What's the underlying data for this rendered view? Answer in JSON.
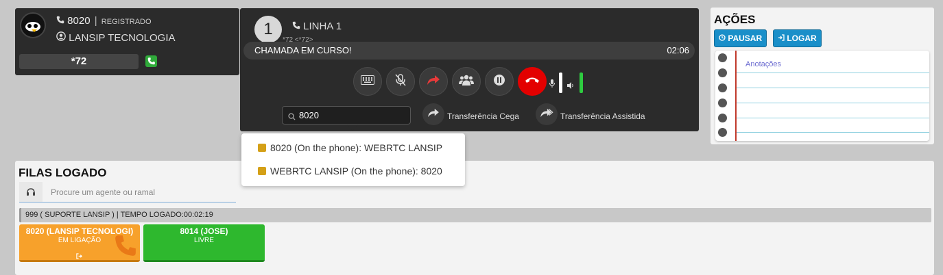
{
  "extension": {
    "number": "8020",
    "separator": "|",
    "status": "REGISTRADO",
    "company": "LANSIP TECNOLOGIA",
    "code": "*72"
  },
  "call": {
    "line_number": "1",
    "line_label": "LINHA 1",
    "line_sub": "*72 <*72>",
    "status": "CHAMADA EM CURSO!",
    "timer": "02:06",
    "search_value": "8020",
    "blind_transfer": "Transferência Cega",
    "assisted_transfer": "Transferência Assistida",
    "buttons": [
      "keypad-icon",
      "mic-muted-icon",
      "forward-icon",
      "group-icon",
      "pause-icon",
      "hangup-icon"
    ],
    "hangup_color": "#e30000"
  },
  "dropdown": {
    "items": [
      "8020 (On the phone): WEBRTC LANSIP",
      "WEBRTC LANSIP (On the phone): 8020"
    ]
  },
  "acoes": {
    "title": "AÇÕES",
    "pause_label": "PAUSAR",
    "login_label": "LOGAR",
    "notes_placeholder": "Anotações",
    "button_color": "#1a8fc9"
  },
  "filas": {
    "title": "FILAS LOGADO",
    "search_placeholder": "Procure um agente ou ramal",
    "queue_info": "999 ( SUPORTE LANSIP ) | TEMPO LOGADO:00:02:19",
    "agents": [
      {
        "name": "8020 (LANSIP TECNOLOGI)",
        "status": "EM LIGAÇÃO",
        "color": "#f7a12b"
      },
      {
        "name": "8014 (JOSE)",
        "status": "LIVRE",
        "color": "#2eb82e"
      }
    ]
  }
}
